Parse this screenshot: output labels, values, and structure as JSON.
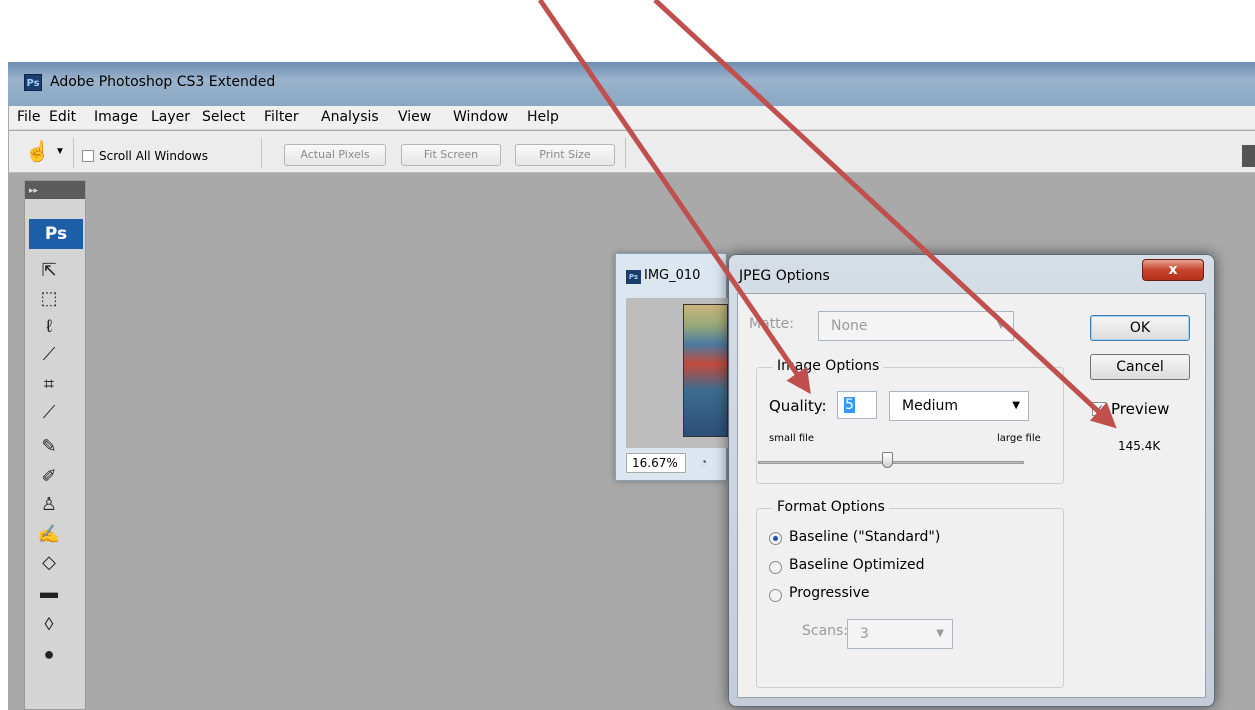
{
  "app": {
    "title": "Adobe Photoshop CS3 Extended",
    "logo_text": "Ps"
  },
  "menu": [
    "File",
    "Edit",
    "Image",
    "Layer",
    "Select",
    "Filter",
    "Analysis",
    "View",
    "Window",
    "Help"
  ],
  "options_bar": {
    "scroll_all_windows_label": "Scroll All Windows",
    "actual_pixels_label": "Actual Pixels",
    "fit_screen_label": "Fit Screen",
    "print_size_label": "Print Size"
  },
  "toolbox": {
    "badge": "Ps",
    "header": "▸▸"
  },
  "document": {
    "title": "IMG_010",
    "zoom": "16.67%"
  },
  "jpeg_dialog": {
    "title": "JPEG Options",
    "close_glyph": "x",
    "matte_label": "Matte:",
    "matte_value": "None",
    "image_options_legend": "Image Options",
    "quality_label": "Quality:",
    "quality_value": "5",
    "quality_preset": "Medium",
    "small_file_label": "small file",
    "large_file_label": "large file",
    "format_options_legend": "Format Options",
    "baseline_standard_label": "Baseline (\"Standard\")",
    "baseline_optimized_label": "Baseline Optimized",
    "progressive_label": "Progressive",
    "scans_label": "Scans:",
    "scans_value": "3",
    "ok_label": "OK",
    "cancel_label": "Cancel",
    "preview_label": "Preview",
    "preview_checked": true,
    "file_size": "145.4K"
  },
  "colors": {
    "workspace_gray": "#a9a9a9",
    "title_bar_blue": "#8aa6c2",
    "close_button_red": "#c8442d",
    "annotation_arrow_red": "#c0504d"
  }
}
